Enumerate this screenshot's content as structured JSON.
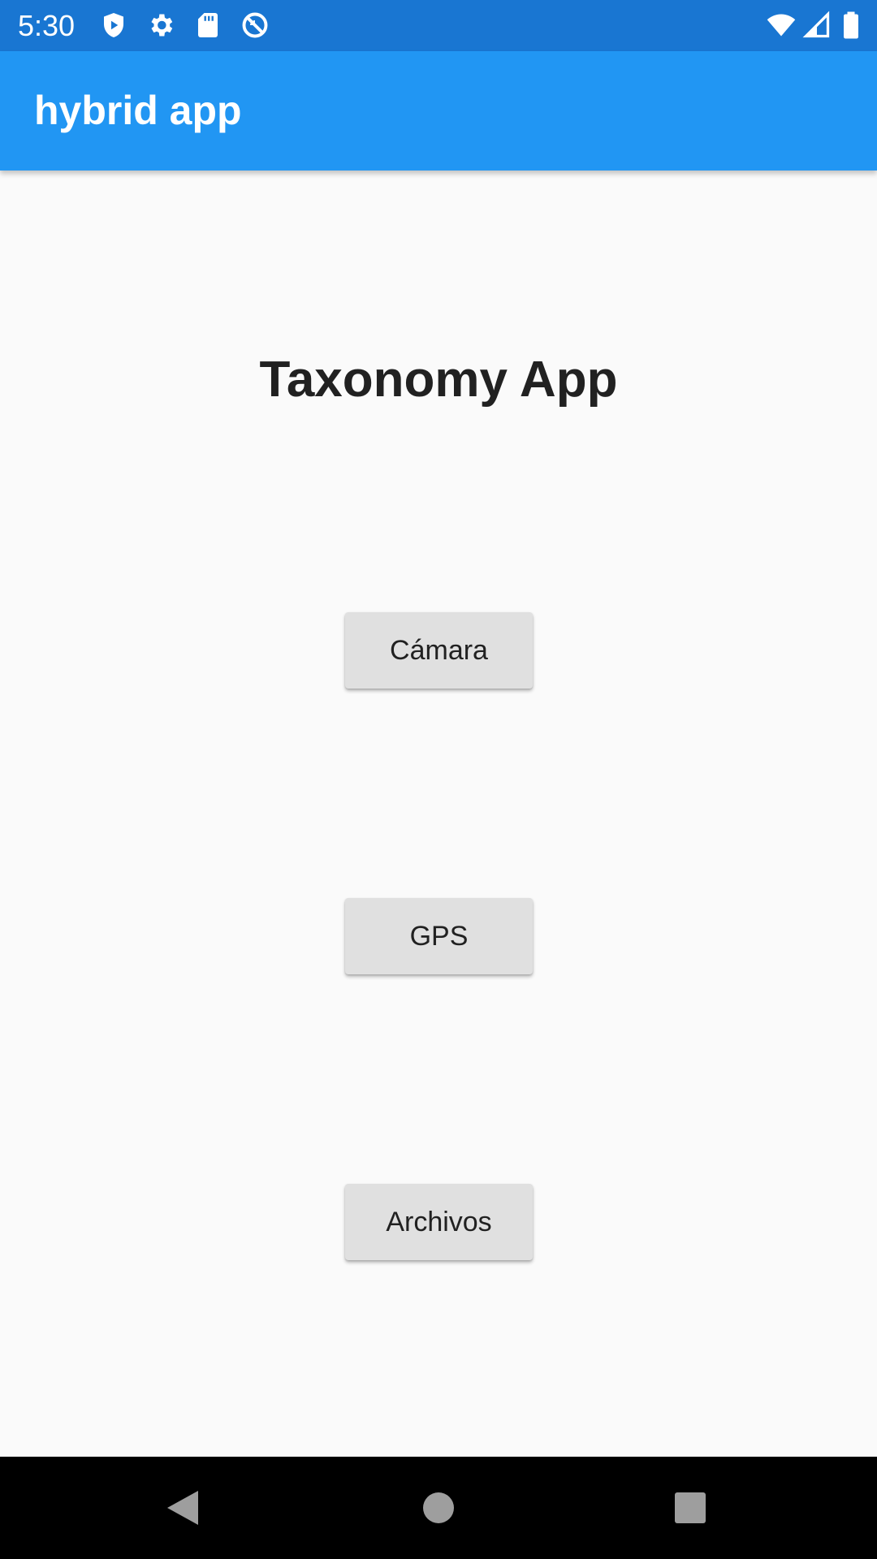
{
  "status_bar": {
    "time": "5:30",
    "left_icons": [
      "shield-play-icon",
      "gear-icon",
      "sd-card-icon",
      "no-sign-icon"
    ],
    "right_icons": [
      "wifi-icon",
      "cell-signal-icon",
      "battery-icon"
    ],
    "background": "#1976d2"
  },
  "app_bar": {
    "title": "hybrid app",
    "background": "#2196f3"
  },
  "main": {
    "title": "Taxonomy App",
    "buttons": [
      {
        "label": "Cámara"
      },
      {
        "label": "GPS"
      },
      {
        "label": "Archivos"
      }
    ],
    "button_color": "#e0e0e0"
  },
  "nav_bar": {
    "icons": [
      "back-icon",
      "home-icon",
      "recents-icon"
    ]
  }
}
